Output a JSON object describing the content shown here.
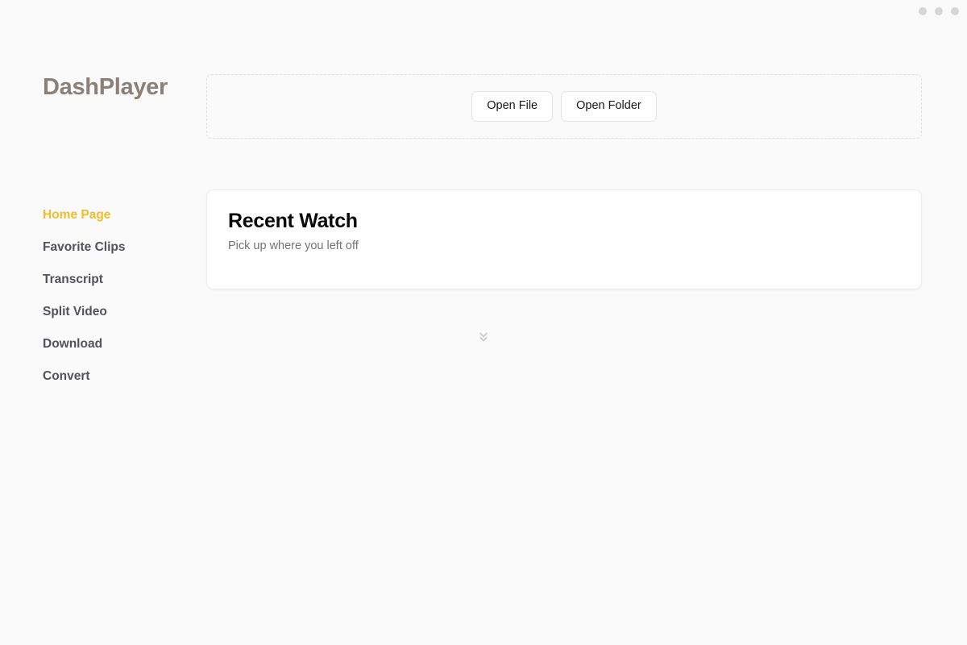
{
  "app": {
    "brand": "DashPlayer",
    "background_color": "#fafafa",
    "accent_color": "#f0bd2e"
  },
  "window_controls": {
    "dots": [
      {
        "name": "window-dot-1",
        "color": "#d6d6d6"
      },
      {
        "name": "window-dot-2",
        "color": "#d6d6d6"
      },
      {
        "name": "window-dot-3",
        "color": "#d6d6d6"
      }
    ]
  },
  "toolbar": {
    "open_file_label": "Open File",
    "open_folder_label": "Open Folder"
  },
  "sidebar": {
    "items": [
      {
        "label": "Home Page",
        "active": true
      },
      {
        "label": "Favorite Clips",
        "active": false
      },
      {
        "label": "Transcript",
        "active": false
      },
      {
        "label": "Split Video",
        "active": false
      },
      {
        "label": "Download",
        "active": false
      },
      {
        "label": "Convert",
        "active": false
      }
    ]
  },
  "main": {
    "recent_watch": {
      "title": "Recent Watch",
      "subtitle": "Pick up where you left off"
    },
    "expand_icon": "chevrons-down-icon"
  }
}
